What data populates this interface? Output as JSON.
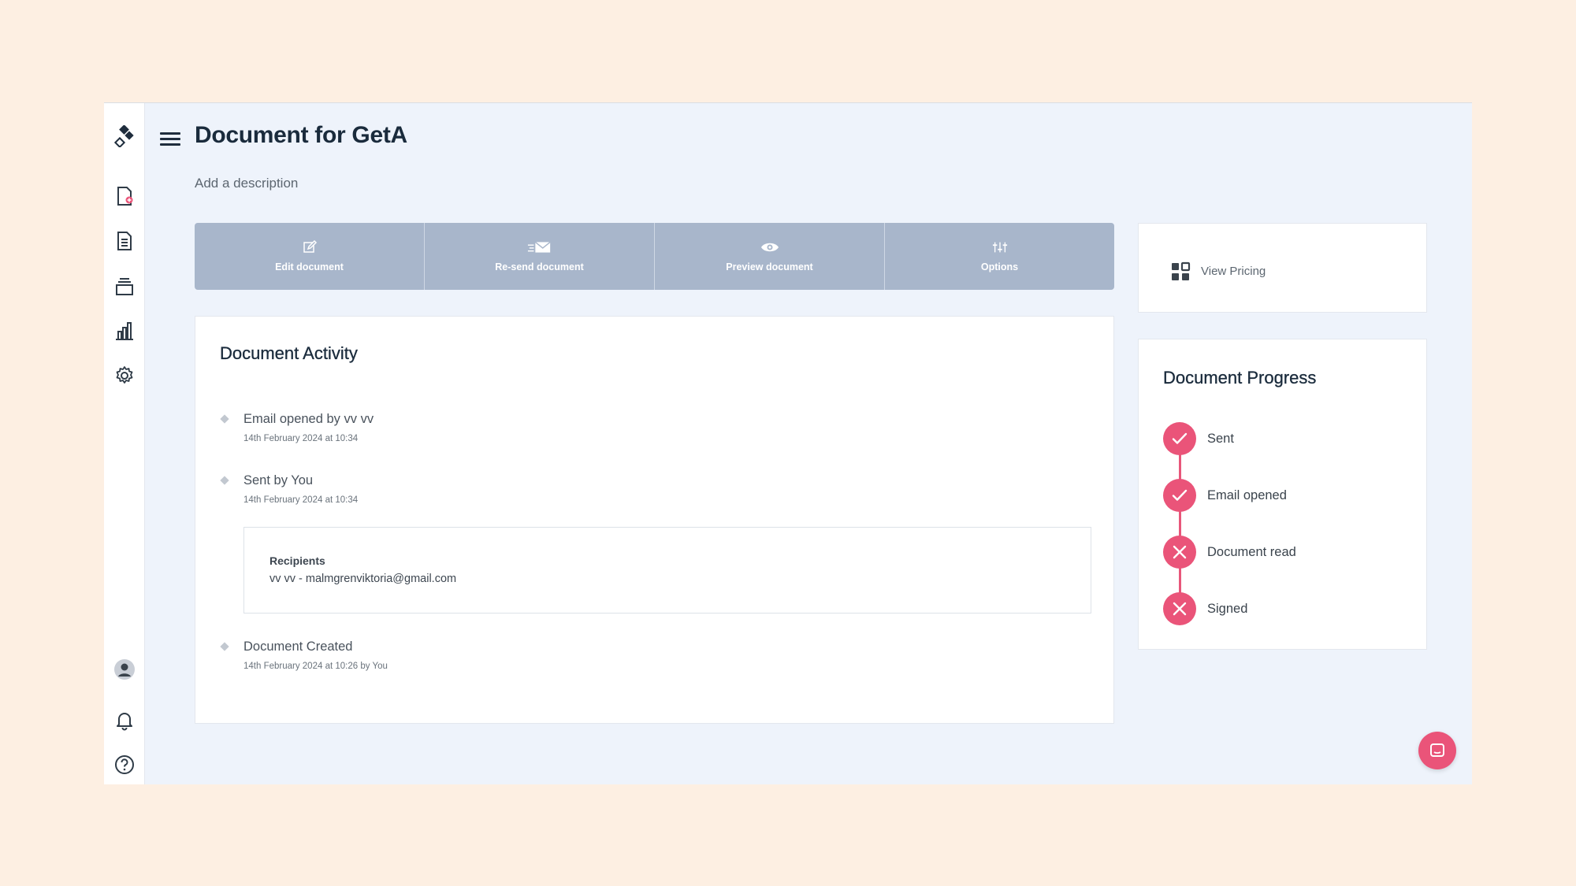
{
  "header": {
    "title": "Document for GetA",
    "description_placeholder": "Add a description"
  },
  "sidebar": {
    "icons": [
      "logo-icon",
      "new-document-icon",
      "documents-icon",
      "templates-icon",
      "reports-icon",
      "settings-icon",
      "avatar-icon",
      "bell-icon",
      "help-icon"
    ]
  },
  "toolbar": {
    "edit_label": "Edit document",
    "resend_label": "Re-send document",
    "preview_label": "Preview document",
    "options_label": "Options"
  },
  "pricing": {
    "label": "View Pricing"
  },
  "activity": {
    "title": "Document Activity",
    "items": [
      {
        "text": "Email opened by vv vv",
        "date": "14th February 2024 at 10:34"
      },
      {
        "text": "Sent by You",
        "date": "14th February 2024 at 10:34"
      },
      {
        "text": "Document Created",
        "date": "14th February 2024 at 10:26 by You"
      }
    ],
    "recipients": {
      "heading": "Recipients",
      "value": "vv vv - malmgrenviktoria@gmail.com"
    }
  },
  "progress": {
    "title": "Document Progress",
    "steps": [
      {
        "label": "Sent",
        "status": "done"
      },
      {
        "label": "Email opened",
        "status": "done"
      },
      {
        "label": "Document read",
        "status": "not-done"
      },
      {
        "label": "Signed",
        "status": "not-done"
      }
    ]
  },
  "colors": {
    "accent": "#ea5479",
    "toolbar": "#a8b6cb",
    "page_background": "#eef3fb",
    "outer_background": "#fdefe2"
  }
}
